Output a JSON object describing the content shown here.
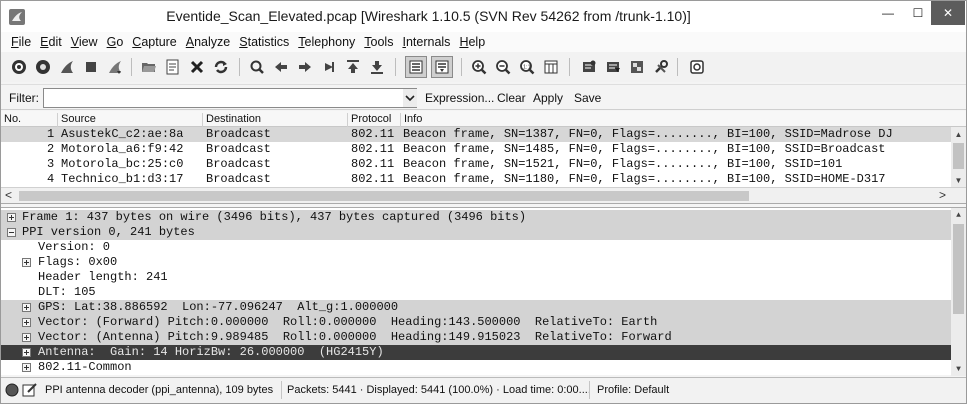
{
  "window": {
    "title": "Eventide_Scan_Elevated.pcap   [Wireshark 1.10.5  (SVN Rev 54262 from /trunk-1.10)]",
    "min_glyph": "—",
    "max_glyph": "☐",
    "close_glyph": "✕"
  },
  "menu": [
    "File",
    "Edit",
    "View",
    "Go",
    "Capture",
    "Analyze",
    "Statistics",
    "Telephony",
    "Tools",
    "Internals",
    "Help"
  ],
  "filter": {
    "label": "Filter:",
    "value": "",
    "expression_label": "Expression...",
    "clear_label": "Clear",
    "apply_label": "Apply",
    "save_label": "Save"
  },
  "packet_list": {
    "columns": [
      "No.",
      "Source",
      "Destination",
      "Protocol",
      "Info"
    ],
    "rows": [
      {
        "no": "1",
        "source": "AsustekC_c2:ae:8a",
        "destination": "Broadcast",
        "protocol": "802.11",
        "info": "Beacon frame, SN=1387, FN=0, Flags=........, BI=100, SSID=Madrose DJ"
      },
      {
        "no": "2",
        "source": "Motorola_a6:f9:42",
        "destination": "Broadcast",
        "protocol": "802.11",
        "info": "Beacon frame, SN=1485, FN=0, Flags=........, BI=100, SSID=Broadcast"
      },
      {
        "no": "3",
        "source": "Motorola_bc:25:c0",
        "destination": "Broadcast",
        "protocol": "802.11",
        "info": "Beacon frame, SN=1521, FN=0, Flags=........, BI=100, SSID=101"
      },
      {
        "no": "4",
        "source": "Technico_b1:d3:17",
        "destination": "Broadcast",
        "protocol": "802.11",
        "info": "Beacon frame, SN=1180, FN=0, Flags=........, BI=100, SSID=HOME-D317"
      }
    ]
  },
  "details": [
    {
      "text": "Frame 1: 437 bytes on wire (3496 bits), 437 bytes captured (3496 bits)",
      "style": "grey",
      "expander": "plus"
    },
    {
      "text": "PPI version 0, 241 bytes",
      "style": "grey",
      "expander": "minus"
    },
    {
      "text": "Version: 0",
      "style": "plain",
      "expander": "none"
    },
    {
      "text": "Flags: 0x00",
      "style": "plain",
      "expander": "plus"
    },
    {
      "text": "Header length: 241",
      "style": "plain",
      "expander": "none"
    },
    {
      "text": "DLT: 105",
      "style": "plain",
      "expander": "none"
    },
    {
      "text": "GPS: Lat:38.886592  Lon:-77.096247  Alt_g:1.000000",
      "style": "grey",
      "expander": "plus"
    },
    {
      "text": "Vector: (Forward) Pitch:0.000000  Roll:0.000000  Heading:143.500000  RelativeTo: Earth",
      "style": "grey",
      "expander": "plus"
    },
    {
      "text": "Vector: (Antenna) Pitch:9.989485  Roll:0.000000  Heading:149.915023  RelativeTo: Forward",
      "style": "grey",
      "expander": "plus"
    },
    {
      "text": "Antenna:  Gain: 14 HorizBw: 26.000000  (HG2415Y)",
      "style": "dark",
      "expander": "plus"
    },
    {
      "text": "802.11-Common",
      "style": "plain",
      "expander": "plus"
    }
  ],
  "status": {
    "field": "PPI antenna decoder (ppi_antenna), 109 bytes",
    "packets": "Packets: 5441 · Displayed: 5441 (100.0%) · Load time: 0:00....",
    "profile": "Profile: Default"
  },
  "scroll": {
    "left_arrow": "<",
    "right_arrow": ">",
    "up_arrow": "▲",
    "down_arrow": "▼"
  }
}
